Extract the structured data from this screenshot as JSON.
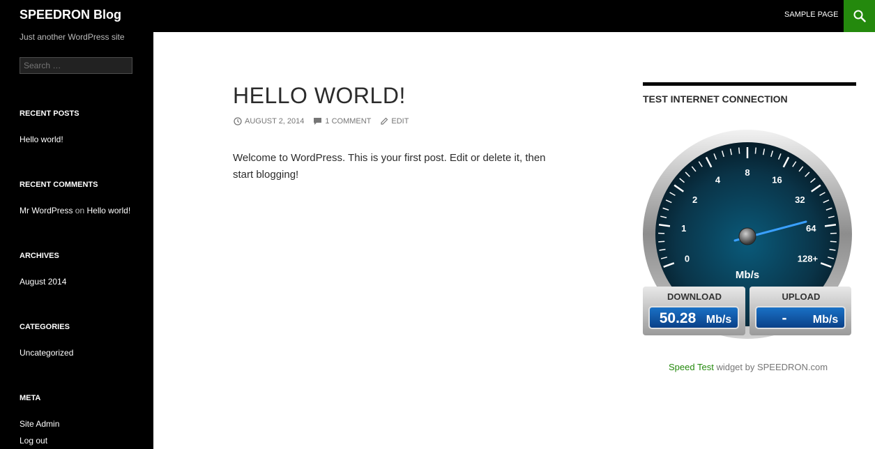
{
  "site": {
    "title": "SPEEDRON Blog",
    "description": "Just another WordPress site"
  },
  "search": {
    "placeholder": "Search …"
  },
  "widgets": {
    "recent_posts": {
      "title": "Recent Posts",
      "item": "Hello world!"
    },
    "recent_comments": {
      "title": "Recent Comments",
      "author": "Mr WordPress",
      "on": "on",
      "post": "Hello world!"
    },
    "archives": {
      "title": "Archives",
      "item": "August 2014"
    },
    "categories": {
      "title": "Categories",
      "item": "Uncategorized"
    },
    "meta": {
      "title": "Meta",
      "items": [
        "Site Admin",
        "Log out"
      ]
    }
  },
  "nav": {
    "sample_page": "Sample Page"
  },
  "post": {
    "title": "Hello world!",
    "date": "August 2, 2014",
    "comments": "1 Comment",
    "edit": "Edit",
    "body": "Welcome to WordPress. This is your first post. Edit or delete it, then start blogging!"
  },
  "speed_widget": {
    "title": "Test Internet Connection",
    "ticks": [
      "0",
      "1",
      "2",
      "4",
      "8",
      "16",
      "32",
      "64",
      "128+"
    ],
    "unit": "Mb/s",
    "download_label": "DOWNLOAD",
    "upload_label": "UPLOAD",
    "download_value": "50.28",
    "download_unit": "Mb/s",
    "upload_value": "-",
    "upload_unit": "Mb/s",
    "credit_link": "Speed Test",
    "credit_rest": "widget by SPEEDRON.com"
  },
  "colors": {
    "accent": "#24890d",
    "sidebar": "#000000"
  }
}
